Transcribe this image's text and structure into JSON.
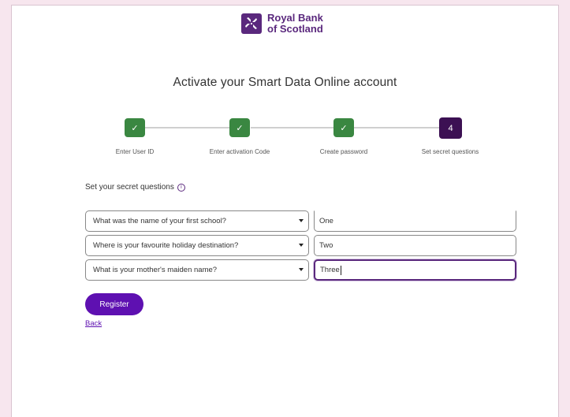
{
  "brand": {
    "name_line1": "Royal Bank",
    "name_line2": "of Scotland",
    "brand_color": "#5a287d",
    "logo_icon": "rbs-daisy-logo"
  },
  "page": {
    "title": "Activate your Smart Data Online account"
  },
  "stepper": {
    "steps": [
      {
        "label": "Enter User ID",
        "state": "done",
        "icon": "check-icon"
      },
      {
        "label": "Enter activation Code",
        "state": "done",
        "icon": "check-icon"
      },
      {
        "label": "Create password",
        "state": "done",
        "icon": "check-icon"
      },
      {
        "label": "Set secret questions",
        "state": "active",
        "number": "4"
      }
    ],
    "done_color": "#3a8741",
    "active_color": "#3c1053"
  },
  "form": {
    "heading": "Set your secret questions",
    "info_icon": "info-icon",
    "rows": [
      {
        "question": "What was the name of your first school?",
        "answer": "One"
      },
      {
        "question": "Where is your favourite holiday destination?",
        "answer": "Two"
      },
      {
        "question": "What is your mother's maiden name?",
        "answer": "Three",
        "focused": true
      }
    ],
    "register_label": "Register",
    "back_label": "Back",
    "accent_color": "#5e10b1"
  }
}
